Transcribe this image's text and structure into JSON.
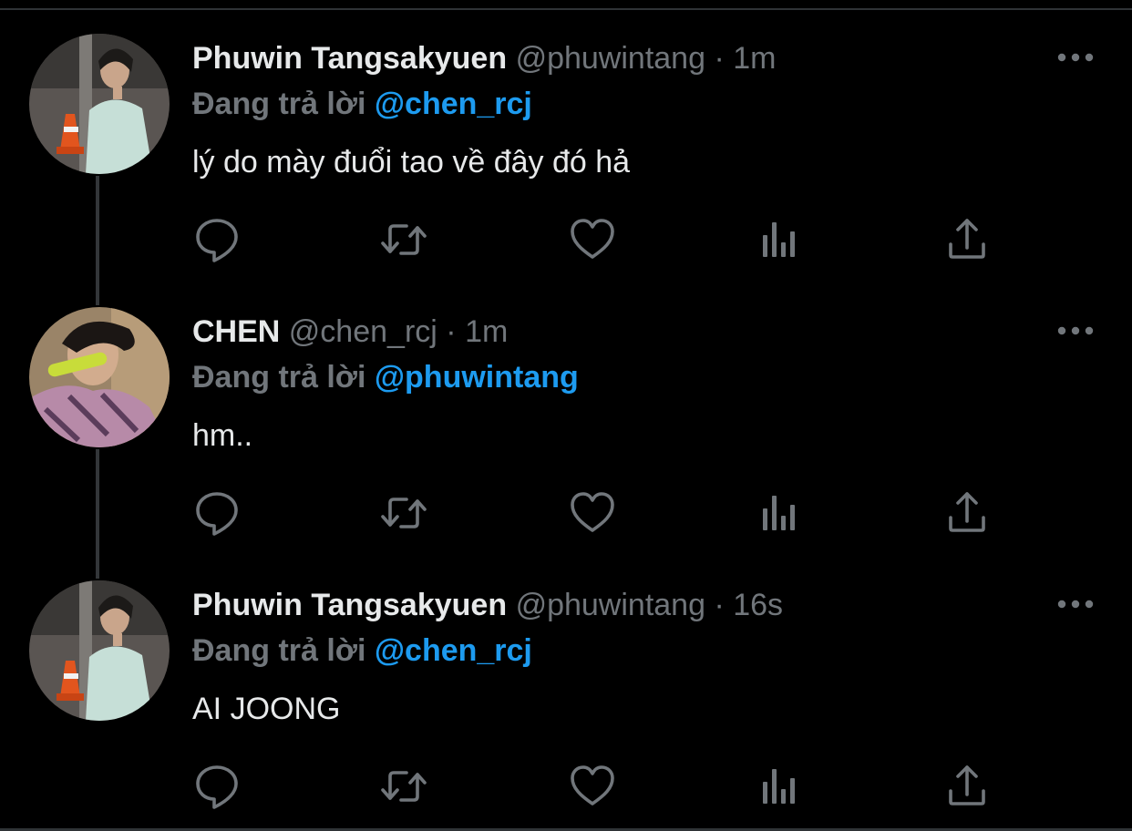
{
  "colors": {
    "background": "#000000",
    "text_primary": "#e7e9ea",
    "text_secondary": "#71767b",
    "accent": "#1d9bf0",
    "divider": "#2f3336"
  },
  "tweets": [
    {
      "name": "Phuwin Tangsakyuen",
      "handle": "@phuwintang",
      "separator": "·",
      "time": "1m",
      "replying_label": "Đang trả lời",
      "replying_to": "@chen_rcj",
      "text": "lý do mày đuổi tao về đây đó hả",
      "actions": [
        "reply-icon",
        "retweet-icon",
        "like-icon",
        "analytics-icon",
        "share-icon"
      ]
    },
    {
      "name": "CHEN",
      "handle": "@chen_rcj",
      "separator": "·",
      "time": "1m",
      "replying_label": "Đang trả lời",
      "replying_to": "@phuwintang",
      "text": "hm..",
      "actions": [
        "reply-icon",
        "retweet-icon",
        "like-icon",
        "analytics-icon",
        "share-icon"
      ]
    },
    {
      "name": "Phuwin Tangsakyuen",
      "handle": "@phuwintang",
      "separator": "·",
      "time": "16s",
      "replying_label": "Đang trả lời",
      "replying_to": "@chen_rcj",
      "text": "AI JOONG",
      "actions": [
        "reply-icon",
        "retweet-icon",
        "like-icon",
        "analytics-icon",
        "share-icon"
      ]
    }
  ]
}
